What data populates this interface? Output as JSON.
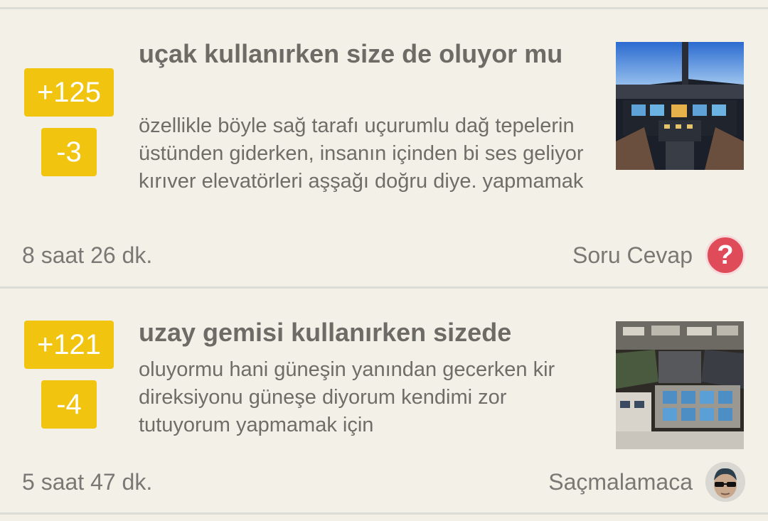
{
  "posts": [
    {
      "upvotes": "+125",
      "downvotes": "-3",
      "title": "uçak kullanırken size de oluyor mu",
      "body": "özellikle böyle sağ tarafı uçurumlu dağ tepelerin üstünden giderken, insanın içinden bi ses geliyor kırıver elevatörleri aşşağı doğru diye. yapmamak",
      "time": "8 saat 26 dk.",
      "category": "Soru Cevap",
      "category_icon": "question-mark-icon",
      "thumbnail": "airplane-cockpit-image",
      "accent": "#f1c40f"
    },
    {
      "upvotes": "+121",
      "downvotes": "-4",
      "title": "uzay gemisi kullanırken sizede",
      "body": "oluyormu hani güneşin yanından gecerken kir direksiyonu güneşe diyorum kendimi zor tutuyorum yapmamak için",
      "time": "5 saat 47 dk.",
      "category": "Saçmalamaca",
      "category_icon": "sunglasses-avatar-icon",
      "thumbnail": "spaceship-cockpit-image",
      "accent": "#f1c40f"
    }
  ]
}
